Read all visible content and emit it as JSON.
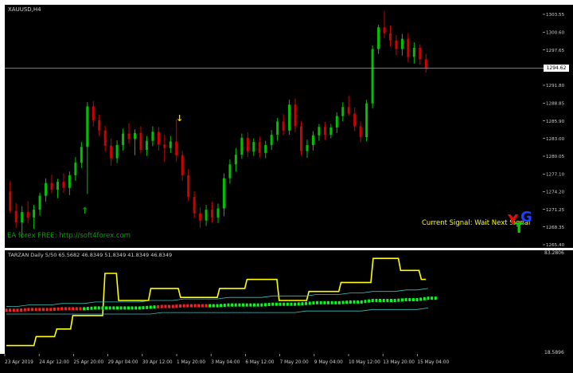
{
  "chart": {
    "symbol_label": "XAUUSD,H4",
    "current_price_tag": "1294.62",
    "promo_text": "EA forex FREE: http://soft4forex.com",
    "signal_text": "Current Signal: Wait Next Signal",
    "logo_letters": [
      "Y",
      "T",
      "G"
    ],
    "colors": {
      "bull": "#00c000",
      "bear": "#d00000",
      "background": "#000000",
      "grid_text": "#cfcfcf",
      "arrow_up": "#00a000",
      "arrow_down": "#ffd700"
    }
  },
  "price_axis": {
    "ticks": [
      "1303.55",
      "1300.60",
      "1297.65",
      "1294.62",
      "1291.80",
      "1288.85",
      "1285.90",
      "1283.00",
      "1280.05",
      "1277.10",
      "1274.20",
      "1271.25",
      "1268.35",
      "1265.40"
    ]
  },
  "indicator": {
    "label": "TARZAN Daily 5/50 65.5682 46.8349 51.8349 41.8349 46.8349",
    "axis_top": "83.2806",
    "axis_bottom": "18.5896",
    "colors": {
      "line": "#ffff00",
      "band": "#40c0c0",
      "dots_bear": "#ff2020",
      "dots_bull": "#00ff20"
    }
  },
  "time_axis": {
    "labels": [
      "23 Apr 2019",
      "24 Apr 12:00",
      "25 Apr 20:00",
      "29 Apr 04:00",
      "30 Apr 12:00",
      "1 May 20:00",
      "3 May 04:00",
      "6 May 12:00",
      "7 May 20:00",
      "9 May 04:00",
      "10 May 12:00",
      "13 May 20:00",
      "15 May 04:00"
    ]
  },
  "chart_data": {
    "type": "candlestick",
    "price_range": [
      1265.4,
      1304.6
    ],
    "candles": [
      [
        1274.2,
        1276.0,
        1270.6,
        1271.0
      ],
      [
        1271.0,
        1272.3,
        1268.2,
        1269.1
      ],
      [
        1269.1,
        1271.8,
        1266.5,
        1270.8
      ],
      [
        1270.8,
        1272.6,
        1268.9,
        1269.9
      ],
      [
        1269.9,
        1272.0,
        1268.0,
        1271.2
      ],
      [
        1271.2,
        1274.0,
        1270.2,
        1273.5
      ],
      [
        1273.5,
        1276.4,
        1272.5,
        1275.6
      ],
      [
        1275.6,
        1277.0,
        1273.9,
        1274.5
      ],
      [
        1274.5,
        1276.3,
        1273.1,
        1275.8
      ],
      [
        1275.8,
        1277.2,
        1274.0,
        1274.8
      ],
      [
        1274.8,
        1277.5,
        1273.6,
        1276.9
      ],
      [
        1276.9,
        1279.9,
        1276.0,
        1279.0
      ],
      [
        1279.0,
        1282.4,
        1278.1,
        1281.6
      ],
      [
        1281.6,
        1289.0,
        1273.8,
        1288.3
      ],
      [
        1288.3,
        1289.2,
        1285.0,
        1286.0
      ],
      [
        1286.0,
        1286.9,
        1283.4,
        1284.3
      ],
      [
        1284.3,
        1285.1,
        1280.8,
        1281.8
      ],
      [
        1281.8,
        1283.0,
        1278.5,
        1279.7
      ],
      [
        1279.7,
        1282.7,
        1278.9,
        1281.9
      ],
      [
        1281.9,
        1284.6,
        1281.0,
        1283.8
      ],
      [
        1283.8,
        1285.5,
        1282.1,
        1282.9
      ],
      [
        1282.9,
        1284.5,
        1280.2,
        1283.9
      ],
      [
        1283.9,
        1285.0,
        1280.5,
        1281.1
      ],
      [
        1281.1,
        1283.4,
        1280.1,
        1282.6
      ],
      [
        1282.6,
        1285.0,
        1281.7,
        1284.1
      ],
      [
        1284.1,
        1284.9,
        1281.0,
        1282.0
      ],
      [
        1282.0,
        1283.6,
        1279.1,
        1281.4
      ],
      [
        1281.4,
        1283.4,
        1280.6,
        1282.5
      ],
      [
        1282.5,
        1286.2,
        1279.2,
        1280.2
      ],
      [
        1280.2,
        1280.9,
        1276.0,
        1276.9
      ],
      [
        1276.9,
        1277.9,
        1272.6,
        1273.3
      ],
      [
        1273.3,
        1274.2,
        1269.8,
        1270.6
      ],
      [
        1270.6,
        1271.6,
        1268.2,
        1269.4
      ],
      [
        1269.4,
        1272.0,
        1268.5,
        1271.2
      ],
      [
        1271.2,
        1272.5,
        1269.1,
        1269.9
      ],
      [
        1269.9,
        1272.2,
        1269.0,
        1271.4
      ],
      [
        1271.4,
        1277.2,
        1270.1,
        1276.4
      ],
      [
        1276.4,
        1279.5,
        1275.5,
        1278.7
      ],
      [
        1278.7,
        1281.4,
        1277.5,
        1280.3
      ],
      [
        1280.3,
        1283.8,
        1279.6,
        1283.1
      ],
      [
        1283.1,
        1284.0,
        1279.9,
        1280.8
      ],
      [
        1280.8,
        1283.0,
        1280.1,
        1282.4
      ],
      [
        1282.4,
        1283.3,
        1279.8,
        1280.6
      ],
      [
        1280.6,
        1282.6,
        1279.7,
        1281.9
      ],
      [
        1281.9,
        1284.4,
        1281.1,
        1283.6
      ],
      [
        1283.6,
        1286.4,
        1282.6,
        1285.8
      ],
      [
        1285.8,
        1287.0,
        1283.5,
        1284.3
      ],
      [
        1284.3,
        1289.4,
        1283.6,
        1288.6
      ],
      [
        1288.6,
        1289.6,
        1284.0,
        1285.0
      ],
      [
        1285.0,
        1285.8,
        1280.2,
        1280.9
      ],
      [
        1280.9,
        1282.8,
        1279.8,
        1281.9
      ],
      [
        1281.9,
        1284.2,
        1281.0,
        1283.5
      ],
      [
        1283.5,
        1285.4,
        1282.6,
        1284.9
      ],
      [
        1284.9,
        1285.7,
        1282.8,
        1283.6
      ],
      [
        1283.6,
        1285.4,
        1283.0,
        1284.8
      ],
      [
        1284.8,
        1287.3,
        1283.9,
        1286.7
      ],
      [
        1286.7,
        1289.0,
        1285.8,
        1288.2
      ],
      [
        1288.2,
        1290.0,
        1286.8,
        1287.1
      ],
      [
        1287.1,
        1288.1,
        1284.2,
        1285.0
      ],
      [
        1285.0,
        1285.8,
        1282.4,
        1283.2
      ],
      [
        1283.2,
        1289.4,
        1282.5,
        1288.8
      ],
      [
        1288.8,
        1298.4,
        1288.0,
        1297.8
      ],
      [
        1297.8,
        1301.8,
        1297.0,
        1301.4
      ],
      [
        1301.4,
        1304.1,
        1299.6,
        1300.4
      ],
      [
        1300.4,
        1301.7,
        1298.2,
        1299.2
      ],
      [
        1299.2,
        1300.1,
        1296.8,
        1297.8
      ],
      [
        1297.8,
        1300.3,
        1296.7,
        1299.5
      ],
      [
        1299.5,
        1300.4,
        1295.6,
        1296.5
      ],
      [
        1296.5,
        1298.9,
        1295.4,
        1298.0
      ],
      [
        1298.0,
        1298.6,
        1295.2,
        1296.1
      ],
      [
        1296.1,
        1297.0,
        1293.9,
        1294.6
      ]
    ],
    "indicator_series": {
      "range": [
        18.5896,
        83.2806
      ],
      "line": [
        22,
        22,
        22,
        22,
        22,
        22,
        22,
        22,
        22,
        22,
        22,
        22,
        22,
        28,
        28,
        28,
        28,
        28,
        28,
        28,
        28,
        28,
        33,
        33,
        33,
        33,
        33,
        33,
        33,
        42,
        42,
        42,
        42,
        42,
        42,
        42,
        42,
        42,
        42,
        42,
        42,
        42,
        42,
        70,
        70,
        70,
        70,
        70,
        70,
        52,
        52,
        52,
        52,
        52,
        52,
        52,
        52,
        52,
        52,
        52,
        52,
        52,
        52,
        60,
        60,
        60,
        60,
        60,
        60,
        60,
        60,
        60,
        60,
        60,
        60,
        60,
        54,
        54,
        54,
        54,
        54,
        54,
        54,
        54,
        54,
        54,
        54,
        54,
        54,
        54,
        54,
        54,
        54,
        60,
        60,
        60,
        60,
        60,
        60,
        60,
        60,
        60,
        60,
        60,
        60,
        66,
        66,
        66,
        66,
        66,
        66,
        66,
        66,
        66,
        66,
        66,
        66,
        66,
        66,
        52,
        52,
        52,
        52,
        52,
        52,
        52,
        52,
        52,
        52,
        52,
        52,
        52,
        58,
        58,
        58,
        58,
        58,
        58,
        58,
        58,
        58,
        58,
        58,
        58,
        58,
        58,
        64,
        64,
        64,
        64,
        64,
        64,
        64,
        64,
        64,
        64,
        64,
        64,
        64,
        64,
        80,
        80,
        80,
        80,
        80,
        80,
        80,
        80,
        80,
        80,
        80,
        80,
        72,
        72,
        72,
        72,
        72,
        72,
        72,
        72,
        72,
        66,
        66,
        66
      ],
      "band_upper": [
        48,
        48,
        49,
        49,
        49,
        50,
        50,
        50,
        51,
        51,
        51,
        51,
        51,
        52,
        52,
        52,
        53,
        53,
        53,
        53,
        54,
        54,
        54,
        54,
        55,
        55,
        55,
        55,
        56,
        56,
        56,
        57,
        57,
        58,
        58,
        58,
        59,
        59,
        60
      ],
      "band_lower": [
        43,
        43,
        43,
        43,
        43,
        43,
        43,
        43,
        43,
        43,
        43,
        43,
        43,
        43,
        44,
        44,
        44,
        44,
        44,
        44,
        44,
        44,
        44,
        44,
        44,
        44,
        44,
        45,
        45,
        45,
        45,
        45,
        45,
        46,
        46,
        46,
        46,
        46,
        47
      ]
    }
  }
}
